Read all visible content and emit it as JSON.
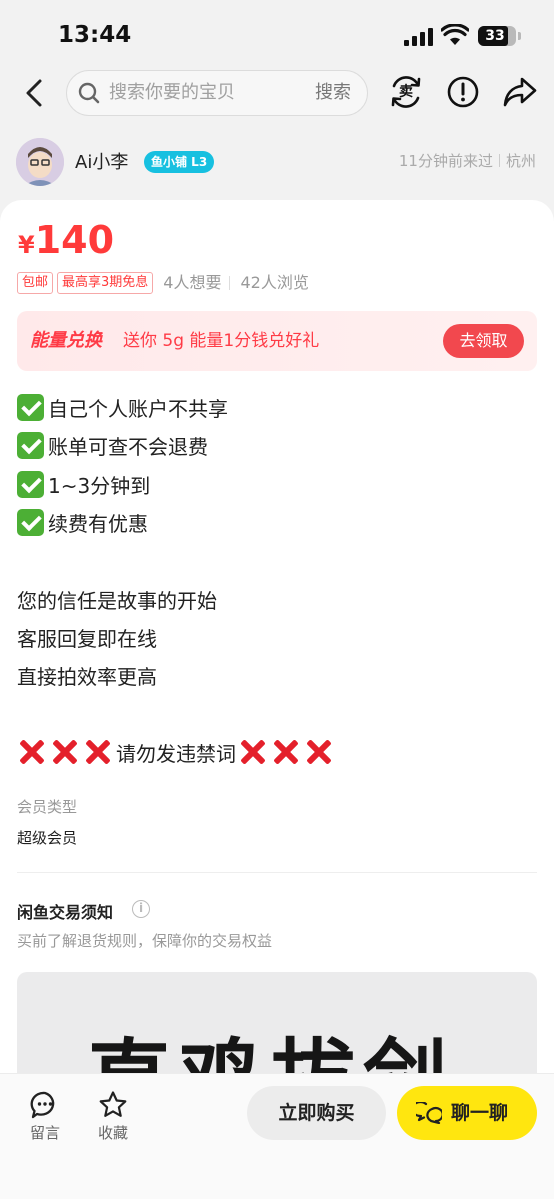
{
  "status_bar": {
    "time": "13:44",
    "battery": "33"
  },
  "header": {
    "search_placeholder": "搜索你要的宝贝",
    "search_button": "搜索",
    "sell_icon_text": "卖"
  },
  "seller": {
    "name": "Ai小李",
    "badge": "鱼小铺 L3",
    "last_seen": "11分钟前来过",
    "location": "杭州"
  },
  "product": {
    "currency": "¥",
    "price": "140",
    "tags": [
      "包邮",
      "最高享3期免息"
    ],
    "wants": "4人想要",
    "views": "42人浏览"
  },
  "energy": {
    "title": "能量兑换",
    "desc": "送你 5g 能量1分钱兑好礼",
    "button": "去领取"
  },
  "description": {
    "checks": [
      "自己个人账户不共享",
      "账单可查不会退费",
      "1~3分钟到",
      "续费有优惠"
    ],
    "lines": [
      "您的信任是故事的开始",
      "客服回复即在线",
      "直接拍效率更高"
    ],
    "warning": "请勿发违禁词"
  },
  "attributes": {
    "label": "会员类型",
    "value": "超级会员"
  },
  "notice": {
    "title": "闲鱼交易须知",
    "subtitle": "买前了解退货规则，保障你的交易权益"
  },
  "image_text": "直鸡拔剑",
  "bottom": {
    "comment": "留言",
    "favorite": "收藏",
    "buy": "立即购买",
    "chat": "聊一聊"
  },
  "colors": {
    "price": "#ff3a3a",
    "accent_yellow": "#ffe60f",
    "badge": "#17c0e0",
    "check": "#4caf35",
    "cross": "#e4202b"
  },
  "icons": [
    "back-icon",
    "search-icon",
    "sell-icon",
    "report-icon",
    "share-icon",
    "info-icon",
    "comment-icon",
    "star-icon",
    "chat-icon"
  ]
}
